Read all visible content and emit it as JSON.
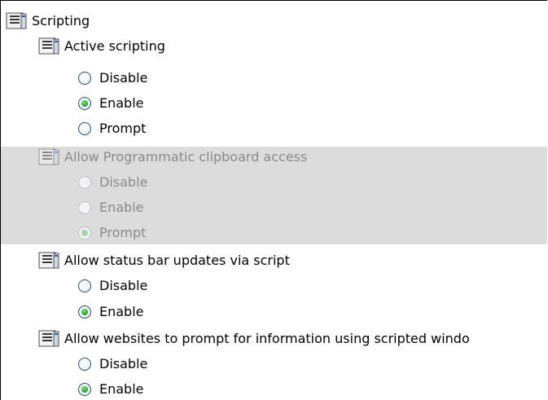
{
  "tree": {
    "root_label": "Scripting",
    "root_icon": "settings-sheet-icon",
    "groups": [
      {
        "label": "Active scripting",
        "icon": "settings-sheet-icon",
        "disabled": false,
        "options": [
          {
            "label": "Disable",
            "checked": false
          },
          {
            "label": "Enable",
            "checked": true
          },
          {
            "label": "Prompt",
            "checked": false
          }
        ]
      },
      {
        "label": "Allow Programmatic clipboard access",
        "icon": "settings-sheet-icon",
        "disabled": true,
        "options": [
          {
            "label": "Disable",
            "checked": false
          },
          {
            "label": "Enable",
            "checked": false
          },
          {
            "label": "Prompt",
            "checked": true
          }
        ]
      },
      {
        "label": "Allow status bar updates via script",
        "icon": "settings-sheet-icon",
        "disabled": false,
        "options": [
          {
            "label": "Disable",
            "checked": false
          },
          {
            "label": "Enable",
            "checked": true
          }
        ]
      },
      {
        "label": "Allow websites to prompt for information using scripted windo",
        "icon": "settings-sheet-icon",
        "disabled": false,
        "options": [
          {
            "label": "Disable",
            "checked": false
          },
          {
            "label": "Enable",
            "checked": true
          }
        ]
      }
    ]
  },
  "colors": {
    "disabled_background": "#dcdcdc",
    "disabled_text": "#8a8a8a",
    "radio_border": "#1c5180",
    "radio_checked": "#2eaa2b"
  }
}
